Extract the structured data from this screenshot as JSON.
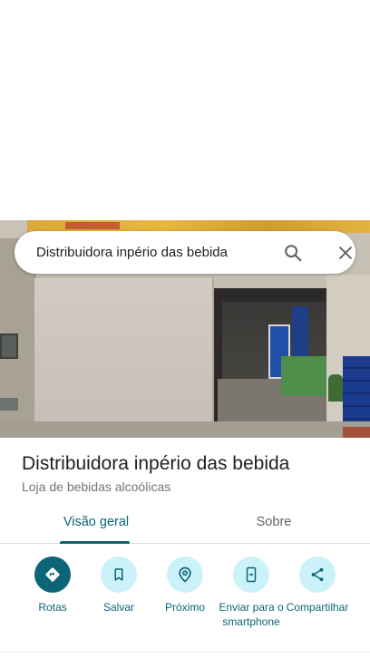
{
  "search": {
    "query": "Distribuidora inpério das bebida",
    "search_icon": "search-icon",
    "close_icon": "close-icon"
  },
  "place": {
    "name": "Distribuidora inpério das bebida",
    "category": "Loja de bebidas alcoólicas"
  },
  "tabs": [
    {
      "label": "Visão geral",
      "active": true
    },
    {
      "label": "Sobre",
      "active": false
    }
  ],
  "actions": [
    {
      "label": "Rotas",
      "icon": "directions-icon"
    },
    {
      "label": "Salvar",
      "icon": "bookmark-icon"
    },
    {
      "label": "Próximo",
      "icon": "nearby-icon"
    },
    {
      "label": "Enviar para o smartphone",
      "icon": "send-to-phone-icon"
    },
    {
      "label": "Compartilhar",
      "icon": "share-icon"
    }
  ],
  "colors": {
    "accent": "#0b6577",
    "action_bg": "#cbf2f8",
    "text_primary": "#202124",
    "text_secondary": "#70757a"
  }
}
